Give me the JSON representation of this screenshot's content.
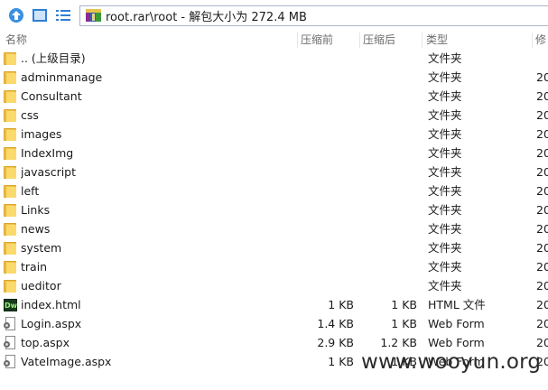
{
  "toolbar": {
    "address": "root.rar\\root - 解包大小为 272.4 MB"
  },
  "columns": {
    "name": "名称",
    "size": "压缩前",
    "packed": "压缩后",
    "type": "类型",
    "modified": "修"
  },
  "files": [
    {
      "name": ".. (上级目录)",
      "size": "",
      "packed": "",
      "type": "文件夹",
      "mod": "",
      "icon": "folder"
    },
    {
      "name": "adminmanage",
      "size": "",
      "packed": "",
      "type": "文件夹",
      "mod": "20",
      "icon": "folder"
    },
    {
      "name": "Consultant",
      "size": "",
      "packed": "",
      "type": "文件夹",
      "mod": "20",
      "icon": "folder"
    },
    {
      "name": "css",
      "size": "",
      "packed": "",
      "type": "文件夹",
      "mod": "20",
      "icon": "folder"
    },
    {
      "name": "images",
      "size": "",
      "packed": "",
      "type": "文件夹",
      "mod": "20",
      "icon": "folder"
    },
    {
      "name": "IndexImg",
      "size": "",
      "packed": "",
      "type": "文件夹",
      "mod": "20",
      "icon": "folder"
    },
    {
      "name": "javascript",
      "size": "",
      "packed": "",
      "type": "文件夹",
      "mod": "20",
      "icon": "folder"
    },
    {
      "name": "left",
      "size": "",
      "packed": "",
      "type": "文件夹",
      "mod": "20",
      "icon": "folder"
    },
    {
      "name": "Links",
      "size": "",
      "packed": "",
      "type": "文件夹",
      "mod": "20",
      "icon": "folder"
    },
    {
      "name": "news",
      "size": "",
      "packed": "",
      "type": "文件夹",
      "mod": "20",
      "icon": "folder"
    },
    {
      "name": "system",
      "size": "",
      "packed": "",
      "type": "文件夹",
      "mod": "20",
      "icon": "folder"
    },
    {
      "name": "train",
      "size": "",
      "packed": "",
      "type": "文件夹",
      "mod": "20",
      "icon": "folder"
    },
    {
      "name": "ueditor",
      "size": "",
      "packed": "",
      "type": "文件夹",
      "mod": "20",
      "icon": "folder"
    },
    {
      "name": "index.html",
      "size": "1 KB",
      "packed": "1 KB",
      "type": "HTML 文件",
      "mod": "20",
      "icon": "dreamweaver"
    },
    {
      "name": "Login.aspx",
      "size": "1.4 KB",
      "packed": "1 KB",
      "type": "Web Form",
      "mod": "20",
      "icon": "aspx"
    },
    {
      "name": "top.aspx",
      "size": "2.9 KB",
      "packed": "1.2 KB",
      "type": "Web Form",
      "mod": "20",
      "icon": "aspx"
    },
    {
      "name": "VateImage.aspx",
      "size": "1 KB",
      "packed": "1 KB",
      "type": "Web Form",
      "mod": "20",
      "icon": "aspx"
    }
  ],
  "dw_icon_text": "Dw",
  "watermark": "www.wooyun.org"
}
